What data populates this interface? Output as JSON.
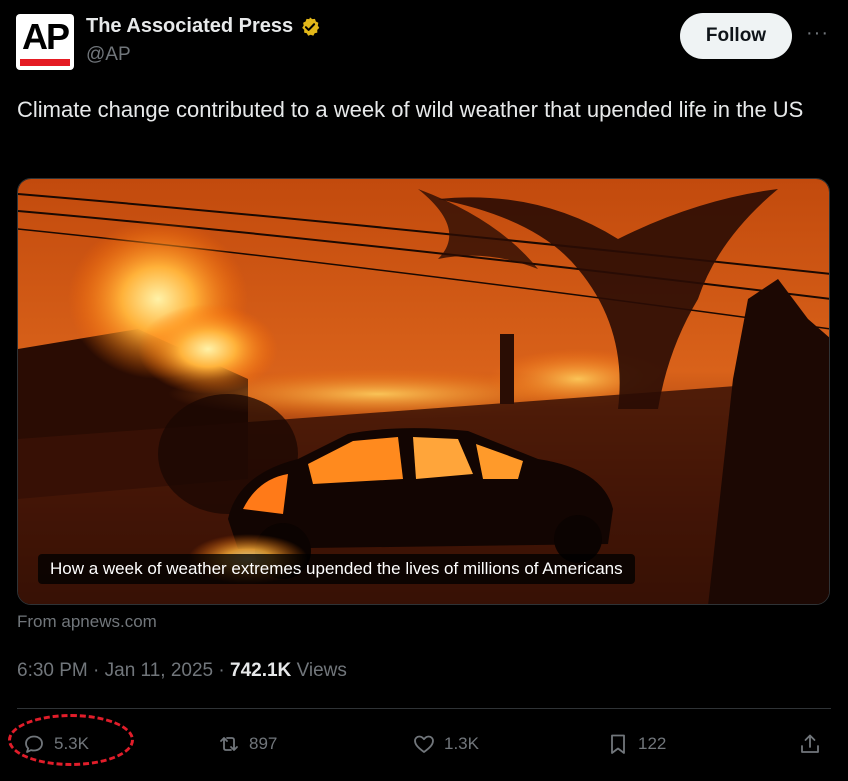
{
  "author": {
    "display_name": "The Associated Press",
    "handle": "@AP",
    "avatar_text": "AP",
    "verified_icon": "gold-verified-badge"
  },
  "header": {
    "follow_label": "Follow",
    "more_label": "···"
  },
  "tweet": {
    "text": "Climate change contributed to a week of wild weather that upended life in the US"
  },
  "media": {
    "caption": "How a week of weather extremes upended the lives of millions of Americans",
    "source": "From apnews.com"
  },
  "meta": {
    "timestamp": "6:30 PM · Jan 11, 2025",
    "separator": " · ",
    "views_count": "742.1K",
    "views_label": "Views"
  },
  "actions": {
    "replies": "5.3K",
    "reposts": "897",
    "likes": "1.3K",
    "bookmarks": "122"
  },
  "colors": {
    "background": "#000000",
    "text": "#e7e9ea",
    "muted": "#71767b",
    "highlight": "#e11d2a",
    "verified": "#e2b719"
  }
}
